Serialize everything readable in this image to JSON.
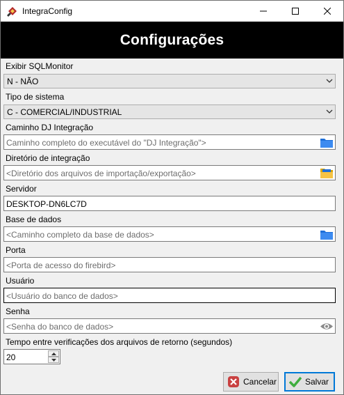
{
  "window": {
    "title": "IntegraConfig",
    "icon": "app-logo-icon"
  },
  "header": {
    "title": "Configurações"
  },
  "fields": {
    "sqlmonitor": {
      "label": "Exibir SQLMonitor",
      "value": "N - NÃO"
    },
    "tipo_sistema": {
      "label": "Tipo de sistema",
      "value": "C - COMERCIAL/INDUSTRIAL"
    },
    "caminho_dj": {
      "label": "Caminho DJ Integração",
      "placeholder": "Caminho completo do executável do \"DJ Integração\">",
      "icon": "folder-icon"
    },
    "diretorio": {
      "label": "Diretório de integração",
      "placeholder": "<Diretório dos arquivos de importação/exportação>",
      "icon": "folder-open-icon"
    },
    "servidor": {
      "label": "Servidor",
      "value": "DESKTOP-DN6LC7D"
    },
    "base_dados": {
      "label": "Base de dados",
      "placeholder": "<Caminho completo da base de dados>",
      "icon": "folder-icon"
    },
    "porta": {
      "label": "Porta",
      "placeholder": "<Porta de acesso do firebird>"
    },
    "usuario": {
      "label": "Usuário",
      "placeholder": "<Usuário do banco de dados>"
    },
    "senha": {
      "label": "Senha",
      "placeholder": "<Senha do banco de dados>",
      "icon": "eye-icon"
    },
    "tempo": {
      "label": "Tempo entre verificações dos arquivos de retorno (segundos)",
      "value": "20"
    }
  },
  "buttons": {
    "cancel": "Cancelar",
    "save": "Salvar"
  },
  "colors": {
    "header_bg": "#000000",
    "header_text": "#ffffff",
    "folder": "#1e6fd9",
    "focus_border": "#0078d7"
  }
}
